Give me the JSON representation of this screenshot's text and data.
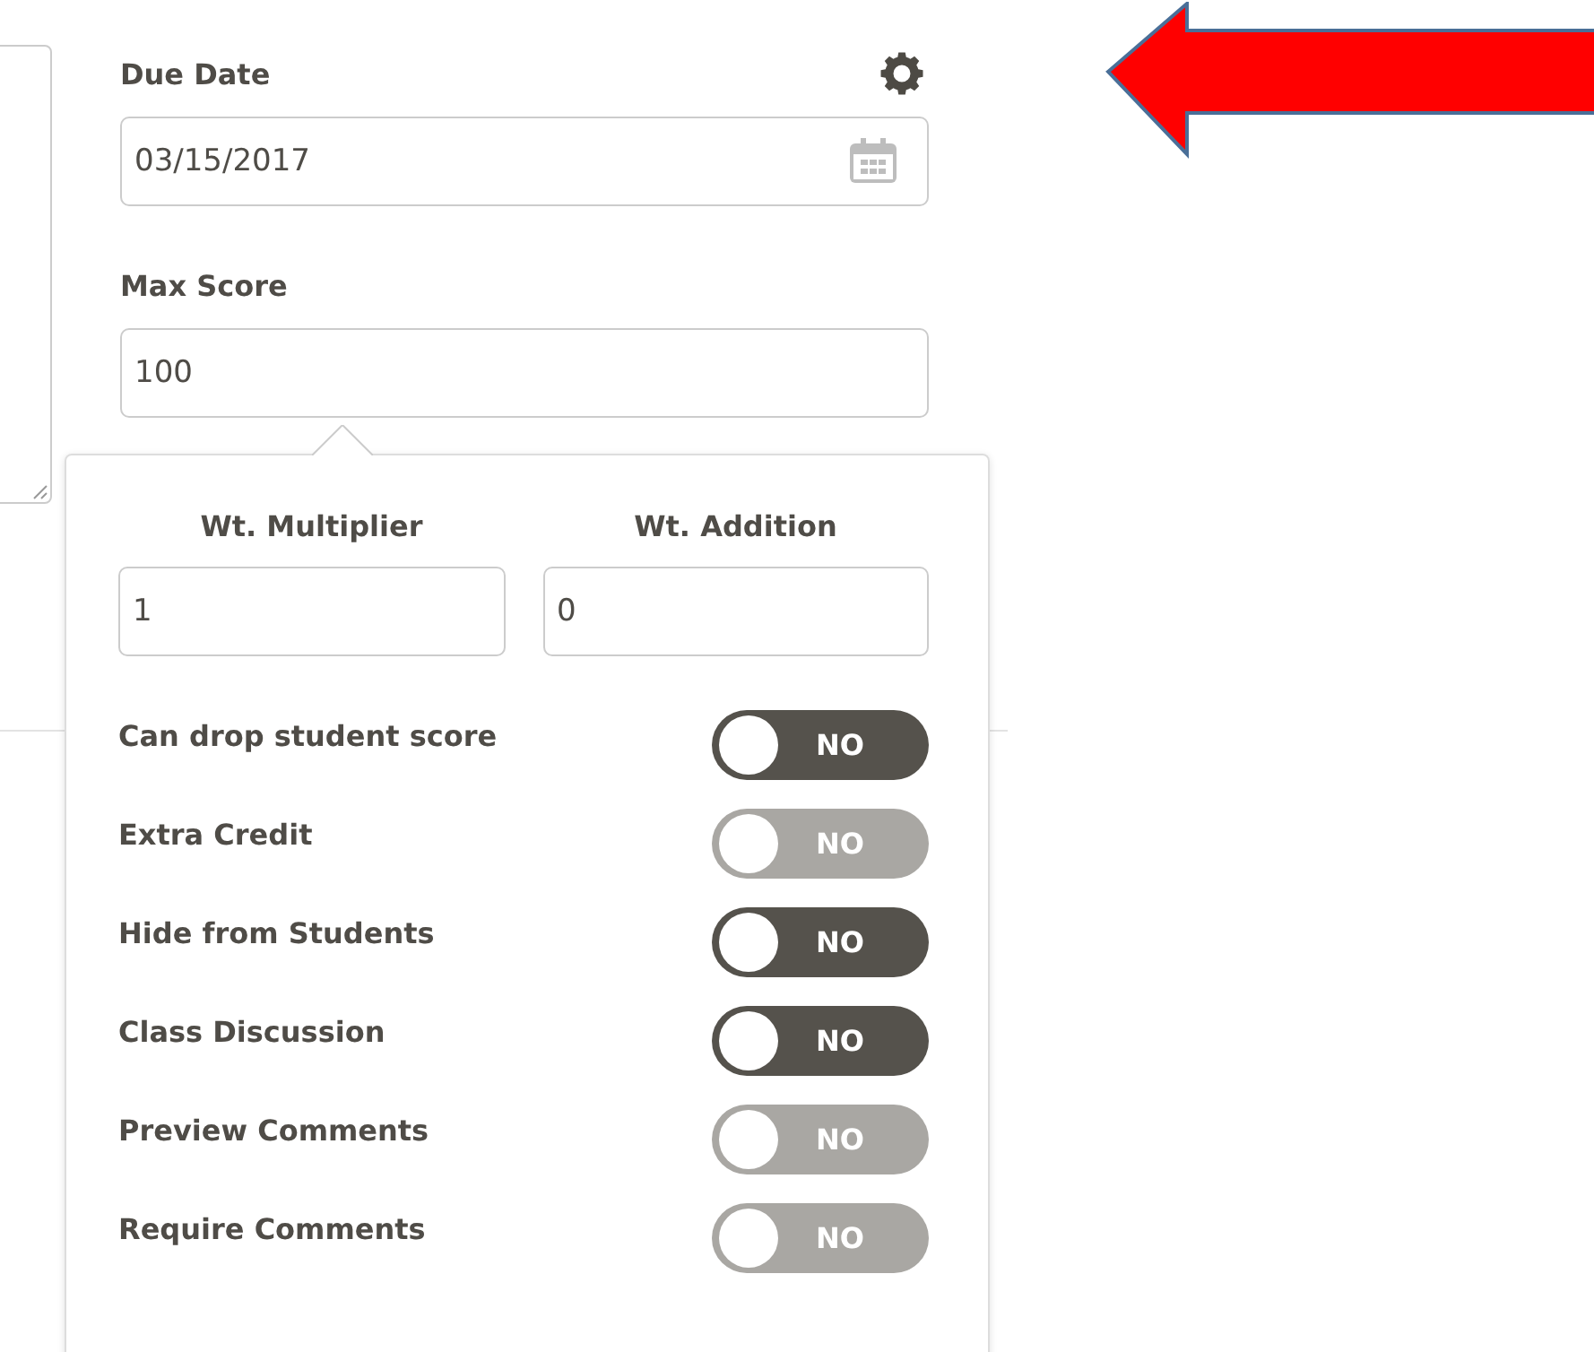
{
  "due_date": {
    "label": "Due Date",
    "value": "03/15/2017"
  },
  "max_score": {
    "label": "Max Score",
    "value": "100"
  },
  "popover": {
    "weights": [
      {
        "label": "Wt. Multiplier",
        "value": "1"
      },
      {
        "label": "Wt. Addition",
        "value": "0"
      }
    ],
    "toggles": [
      {
        "label": "Can drop student score",
        "state": "NO",
        "on": false,
        "disabled": false
      },
      {
        "label": "Extra Credit",
        "state": "NO",
        "on": false,
        "disabled": true
      },
      {
        "label": "Hide from Students",
        "state": "NO",
        "on": false,
        "disabled": false
      },
      {
        "label": "Class Discussion",
        "state": "NO",
        "on": false,
        "disabled": false
      },
      {
        "label": "Preview Comments",
        "state": "NO",
        "on": false,
        "disabled": true
      },
      {
        "label": "Require Comments",
        "state": "NO",
        "on": false,
        "disabled": true
      }
    ]
  }
}
